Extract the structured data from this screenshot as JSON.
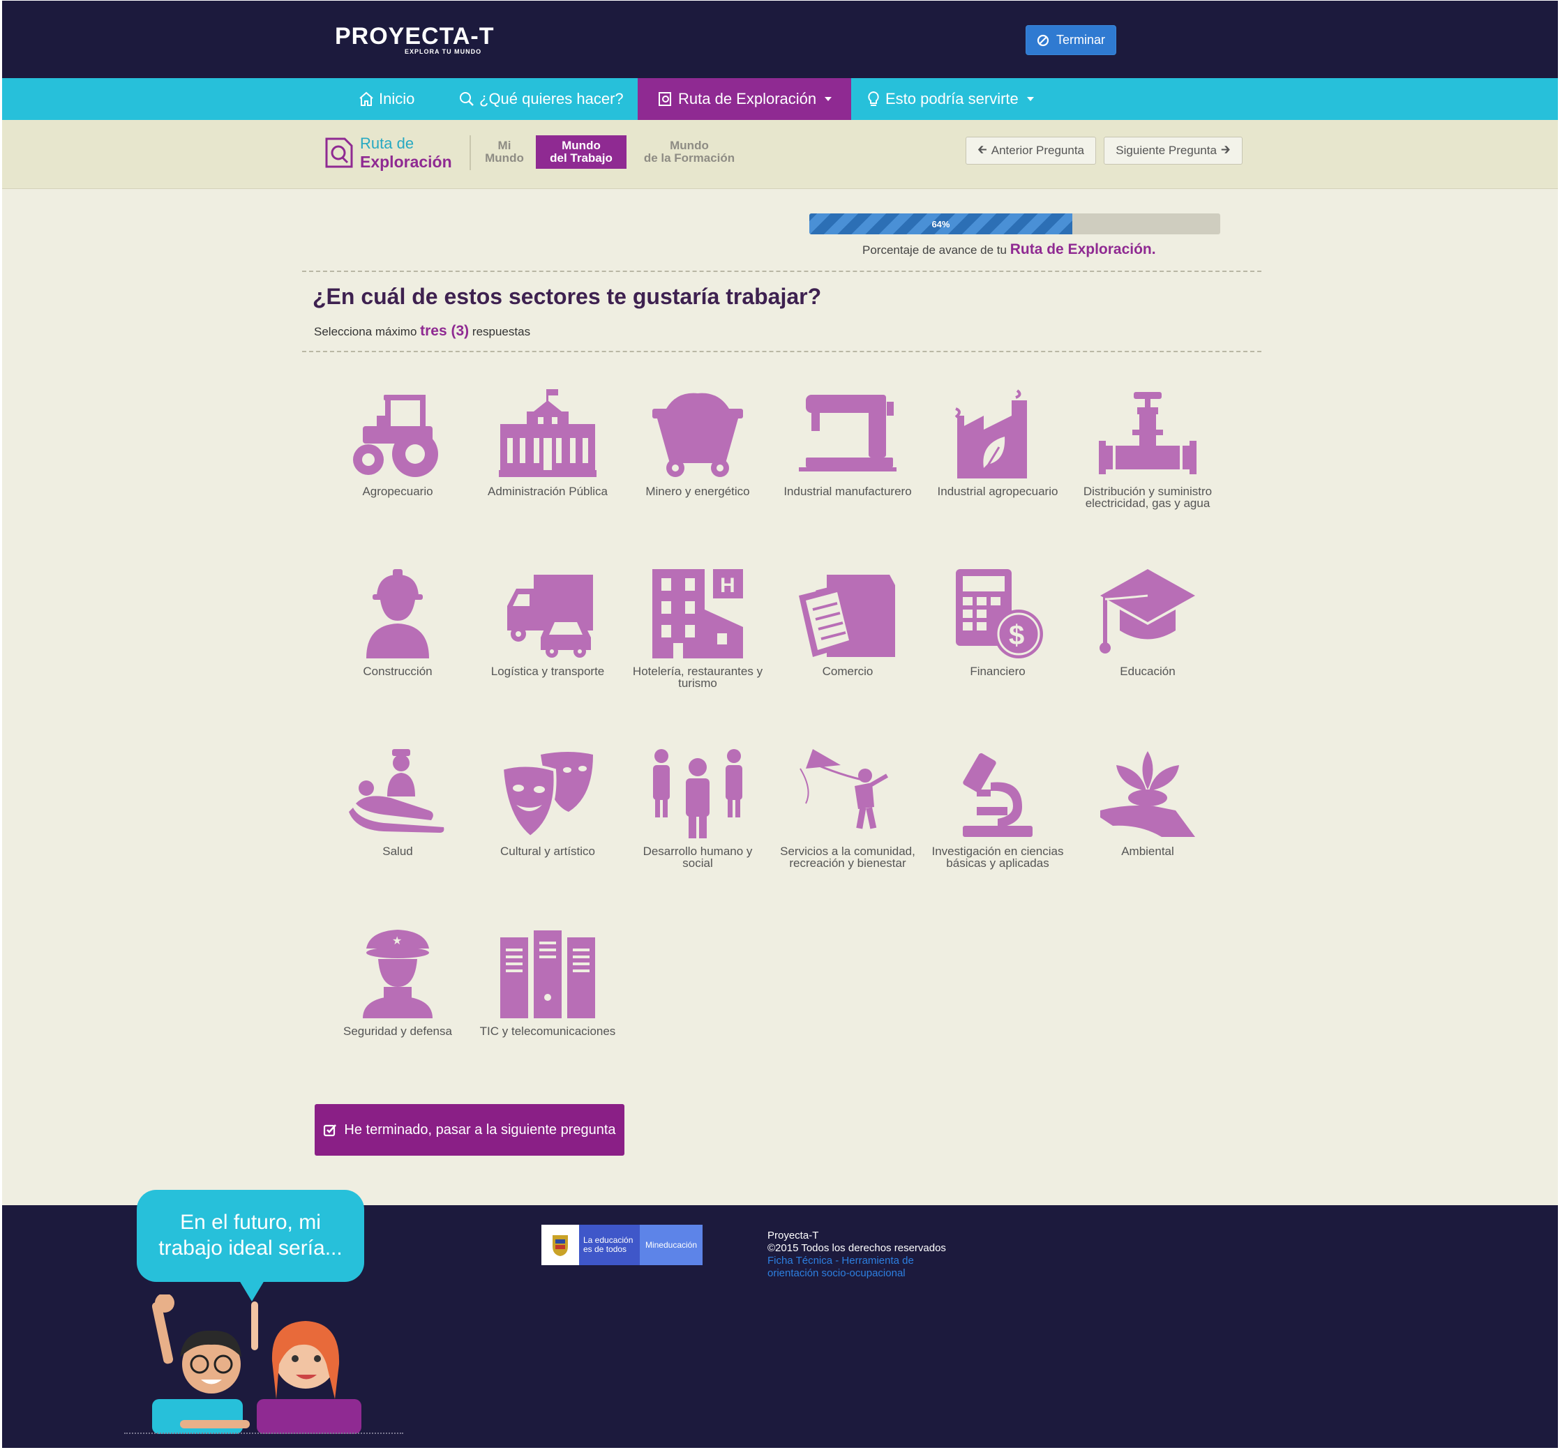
{
  "header": {
    "logo_text": "PROYECTA-T",
    "logo_tagline": "EXPLORA TU MUNDO",
    "finish_button": "Terminar"
  },
  "nav": {
    "items": [
      {
        "label": "Inicio",
        "icon": "home-icon"
      },
      {
        "label": "¿Qué quieres hacer?",
        "icon": "search-icon"
      },
      {
        "label": "Ruta de Exploración",
        "icon": "route-icon",
        "active": true,
        "dropdown": true
      },
      {
        "label": "Esto podría servirte",
        "icon": "lightbulb-icon",
        "dropdown": true
      }
    ]
  },
  "subnav": {
    "route_line1": "Ruta de",
    "route_line2": "Exploración",
    "tabs": [
      {
        "line1": "Mi",
        "line2": "Mundo"
      },
      {
        "line1": "Mundo",
        "line2": "del Trabajo",
        "active": true
      },
      {
        "line1": "Mundo",
        "line2": "de la Formación"
      }
    ],
    "prev_button": "Anterior Pregunta",
    "next_button": "Siguiente Pregunta"
  },
  "progress": {
    "percent": 64,
    "label": "64%",
    "caption_prefix": "Porcentaje de avance de tu",
    "caption_highlight": "Ruta de Exploración."
  },
  "question": {
    "title": "¿En cuál de estos sectores te gustaría trabajar?",
    "instruction_prefix": "Selecciona máximo",
    "instruction_highlight": "tres (3)",
    "instruction_suffix": "respuestas"
  },
  "sectors": [
    {
      "label": "Agropecuario",
      "icon": "tractor-icon"
    },
    {
      "label": "Administración Pública",
      "icon": "government-building-icon"
    },
    {
      "label": "Minero y energético",
      "icon": "mine-cart-icon"
    },
    {
      "label": "Industrial manufacturero",
      "icon": "sewing-machine-icon"
    },
    {
      "label": "Industrial agropecuario",
      "icon": "factory-leaf-icon"
    },
    {
      "label": "Distribución y suministro electricidad, gas y agua",
      "icon": "pipe-valve-icon"
    },
    {
      "label": "Construcción",
      "icon": "construction-worker-icon"
    },
    {
      "label": "Logística y transporte",
      "icon": "truck-car-icon"
    },
    {
      "label": "Hotelería, restaurantes y turismo",
      "icon": "hotel-icon"
    },
    {
      "label": "Comercio",
      "icon": "clipboard-box-icon"
    },
    {
      "label": "Financiero",
      "icon": "calculator-dollar-icon"
    },
    {
      "label": "Educación",
      "icon": "graduation-cap-icon"
    },
    {
      "label": "Salud",
      "icon": "patient-nurse-icon"
    },
    {
      "label": "Cultural y artístico",
      "icon": "theater-masks-icon"
    },
    {
      "label": "Desarrollo humano y social",
      "icon": "people-group-icon"
    },
    {
      "label": "Servicios a la comunidad, recreación y bienestar",
      "icon": "kite-child-icon"
    },
    {
      "label": "Investigación en ciencias básicas y aplicadas",
      "icon": "microscope-icon"
    },
    {
      "label": "Ambiental",
      "icon": "hand-plant-icon"
    },
    {
      "label": "Seguridad y defensa",
      "icon": "police-officer-icon"
    },
    {
      "label": "TIC y telecomunicaciones",
      "icon": "server-racks-icon"
    }
  ],
  "submit_button": "He terminado, pasar a la siguiente pregunta",
  "footer": {
    "bubble_line1": "En el futuro, mi",
    "bubble_line2": "trabajo ideal sería...",
    "mineducacion_line1": "La educación",
    "mineducacion_line2": "es de todos",
    "mineducacion_brand": "Mineducación",
    "site_name": "Proyecta-T",
    "copyright": "©2015 Todos los derechos reservados",
    "link": "Ficha Técnica - Herramienta de orientación socio-ocupacional"
  },
  "colors": {
    "dark_navy": "#1c1a3d",
    "cyan": "#27c0da",
    "purple": "#8f2a92",
    "icon_purple": "#b86eb6",
    "background": "#efeee1"
  }
}
